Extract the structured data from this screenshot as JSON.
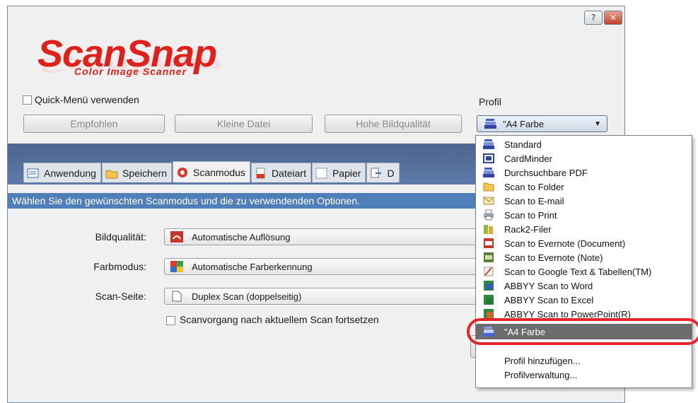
{
  "window": {
    "help_label": "?",
    "close_label": "✕"
  },
  "logo": {
    "name": "ScanSnap",
    "subtitle": "Color Image Scanner"
  },
  "quick_menu": {
    "checkbox_label": "Quick-Menü verwenden",
    "checked": false
  },
  "profile": {
    "label": "Profil",
    "selected": "\"A4 Farbe"
  },
  "quick_buttons": {
    "empfohlen": "Empfohlen",
    "klein": "Kleine Datei",
    "hohe": "Hohe Bildqualität"
  },
  "tabs": [
    {
      "label": "Anwendung",
      "icon": "application-icon",
      "active": false
    },
    {
      "label": "Speichern",
      "icon": "folder-icon",
      "active": false
    },
    {
      "label": "Scanmodus",
      "icon": "scanmode-icon",
      "active": true
    },
    {
      "label": "Dateiart",
      "icon": "file-icon",
      "active": false
    },
    {
      "label": "Papier",
      "icon": "paper-icon",
      "active": false
    },
    {
      "label": "D",
      "icon": "compress-icon",
      "active": false
    }
  ],
  "content": {
    "info": "Wählen Sie den gewünschten Scanmodus und die zu verwendenden Optionen.",
    "bildqualitaet_label": "Bildqualität:",
    "bildqualitaet_value": "Automatische Auflösung",
    "farbmodus_label": "Farbmodus:",
    "farbmodus_value": "Automatische Farberkennung",
    "scanseite_label": "Scan-Seite:",
    "scanseite_value": "Duplex Scan (doppelseitig)",
    "continue_label": "Scanvorgang nach aktuellem Scan fortsetzen"
  },
  "dropdown": {
    "items": [
      {
        "label": "Standard",
        "icon": "scanner-icon"
      },
      {
        "label": "CardMinder",
        "icon": "cardminder-icon"
      },
      {
        "label": "Durchsuchbare PDF",
        "icon": "scanner-icon"
      },
      {
        "label": "Scan to Folder",
        "icon": "folder-icon"
      },
      {
        "label": "Scan to E-mail",
        "icon": "email-icon"
      },
      {
        "label": "Scan to Print",
        "icon": "printer-icon"
      },
      {
        "label": "Rack2-Filer",
        "icon": "rack2filer-icon"
      },
      {
        "label": "Scan to Evernote (Document)",
        "icon": "pdf-icon"
      },
      {
        "label": "Scan to Evernote (Note)",
        "icon": "jpg-icon"
      },
      {
        "label": "Scan to Google Text & Tabellen(TM)",
        "icon": "google-icon"
      },
      {
        "label": "ABBYY Scan to Word",
        "icon": "abbyy-word-icon"
      },
      {
        "label": "ABBYY Scan to Excel",
        "icon": "abbyy-excel-icon"
      },
      {
        "label": "ABBYY Scan to PowerPoint(R)",
        "icon": "abbyy-ppt-icon"
      },
      {
        "label": "\"A4 Farbe",
        "icon": "scanner-icon",
        "selected": true
      }
    ],
    "add_profile": "Profil hinzufügen...",
    "manage_profiles": "Profilverwaltung..."
  },
  "colors": {
    "brand_red": "#e0201b",
    "band_blue": "#5570a0",
    "info_bar": "#4f7eb8",
    "highlight": "#e3262c"
  }
}
